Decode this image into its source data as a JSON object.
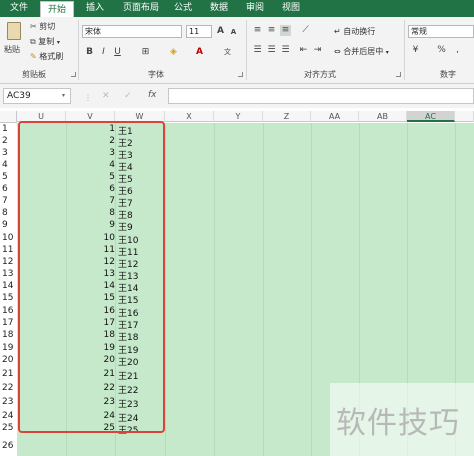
{
  "tabs": [
    "文件",
    "开始",
    "插入",
    "页面布局",
    "公式",
    "数据",
    "审阅",
    "视图"
  ],
  "ribbon": {
    "paste": "粘贴",
    "cut": "剪切",
    "copy": "复制",
    "format_painter": "格式刷",
    "font_name": "宋体",
    "font_size": "11",
    "wrap_text": "自动换行",
    "merge_center": "合并后居中",
    "number_format": "常规",
    "percent": "%",
    "comma": ",",
    "groups": {
      "clipboard": "剪贴板",
      "font": "字体",
      "alignment": "对齐方式",
      "number": "数字"
    }
  },
  "formula_bar": {
    "name_box": "AC39",
    "cancel": "✕",
    "enter": "✓",
    "fx": "fx"
  },
  "columns": [
    "U",
    "V",
    "W",
    "X",
    "Y",
    "Z",
    "AA",
    "AB",
    "AC"
  ],
  "selected_column": "AC",
  "rows": [
    {
      "row": "1",
      "num": "1",
      "name": "王1"
    },
    {
      "row": "2",
      "num": "2",
      "name": "王2"
    },
    {
      "row": "3",
      "num": "3",
      "name": "王3"
    },
    {
      "row": "4",
      "num": "4",
      "name": "王4"
    },
    {
      "row": "5",
      "num": "5",
      "name": "王5"
    },
    {
      "row": "6",
      "num": "6",
      "name": "王6"
    },
    {
      "row": "7",
      "num": "7",
      "name": "王7"
    },
    {
      "row": "8",
      "num": "8",
      "name": "王8"
    },
    {
      "row": "9",
      "num": "9",
      "name": "王9"
    },
    {
      "row": "10",
      "num": "10",
      "name": "王10"
    },
    {
      "row": "11",
      "num": "11",
      "name": "王11"
    },
    {
      "row": "12",
      "num": "12",
      "name": "王12"
    },
    {
      "row": "13",
      "num": "13",
      "name": "王13"
    },
    {
      "row": "14",
      "num": "14",
      "name": "王14"
    },
    {
      "row": "15",
      "num": "15",
      "name": "王15"
    },
    {
      "row": "16",
      "num": "16",
      "name": "王16"
    },
    {
      "row": "17",
      "num": "17",
      "name": "王17"
    },
    {
      "row": "18",
      "num": "18",
      "name": "王18"
    },
    {
      "row": "19",
      "num": "19",
      "name": "王19"
    },
    {
      "row": "20",
      "num": "20",
      "name": "王20"
    },
    {
      "row": "21",
      "num": "21",
      "name": "王21"
    },
    {
      "row": "22",
      "num": "22",
      "name": "王22"
    },
    {
      "row": "23",
      "num": "23",
      "name": "王23"
    },
    {
      "row": "24",
      "num": "24",
      "name": "王24"
    },
    {
      "row": "25",
      "num": "25",
      "name": "王25"
    },
    {
      "row": "26",
      "num": "",
      "name": ""
    }
  ],
  "watermark": "软件技巧",
  "colors": {
    "brand": "#217346",
    "sheet_fill": "#c6e9cb",
    "highlight_box": "#d9433a"
  }
}
